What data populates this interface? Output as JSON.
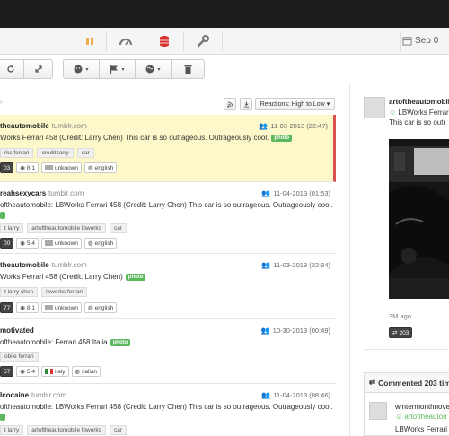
{
  "nav": {
    "date": "Sep 0"
  },
  "controls": {
    "sort": "Reactions: High to Low"
  },
  "posts": [
    {
      "user": "theautomobile",
      "source": "tumblr.com",
      "date": "11-03-2013 (22:47)",
      "text": "Works Ferrari 458 (Credit: Larry Chen) This car is so outrageous. Outrageously cool.",
      "badge": "photo",
      "tags": [
        "rks ferrari",
        "credit larry",
        "car"
      ],
      "stats": {
        "count": "03",
        "score": "8.1",
        "country": "unknown",
        "lang": "english"
      }
    },
    {
      "user": "reahsexycars",
      "source": "tumblr.com",
      "date": "11-04-2013 (01:53)",
      "text": "oftheautomobile: LBWorks Ferrari 458 (Credit: Larry Chen) This car is so outrageous. Outrageously cool.",
      "badge": "",
      "tags": [
        "t larry",
        "artoftheautomobile lbworks",
        "car"
      ],
      "stats": {
        "count": "00",
        "score": "5.4",
        "country": "unknown",
        "lang": "english"
      }
    },
    {
      "user": "theautomobile",
      "source": "tumblr.com",
      "date": "11-03-2013 (22:34)",
      "text": "Works Ferrari 458 (Credit: Larry Chen)",
      "badge": "photo",
      "tags": [
        "t larry chen",
        "lbworks ferrari"
      ],
      "stats": {
        "count": "77",
        "score": "8.1",
        "country": "unknown",
        "lang": "english"
      }
    },
    {
      "user": "motivated",
      "source": "",
      "date": "10-30-2013 (00:49)",
      "text": "oftheautomobile: Ferrari 458 Italia",
      "badge": "photo",
      "tags": [
        "obile ferrari"
      ],
      "stats": {
        "count": "57",
        "score": "5.4",
        "country": "italy",
        "lang": "italian"
      }
    },
    {
      "user": "lcocaine",
      "source": "tumblr.com",
      "date": "11-04-2013 (08:46)",
      "text": "oftheautomobile: LBWorks Ferrari 458 (Credit: Larry Chen) This car is so outrageous. Outrageously cool.",
      "badge": "",
      "tags": [
        "t larry",
        "artoftheautomobile lbworks",
        "car"
      ],
      "stats": {}
    }
  ],
  "detail": {
    "user": "artoftheautomobile",
    "handle": "LBWorks Ferrari",
    "text": "This car is so outr",
    "meta": "3M ago",
    "reblogs": "203",
    "commented": "Commented 203 tim",
    "c_user": "wintermonthnove",
    "c_handle": "artoftheauton",
    "c_text1": "LBWorks Ferrari",
    "c_text2": "This car is so out"
  },
  "colors": {
    "accent_green": "#5cb85c",
    "highlight": "#fcf8c9",
    "alert_red": "#d9534f",
    "icon_blue": "#3a6fc4"
  }
}
